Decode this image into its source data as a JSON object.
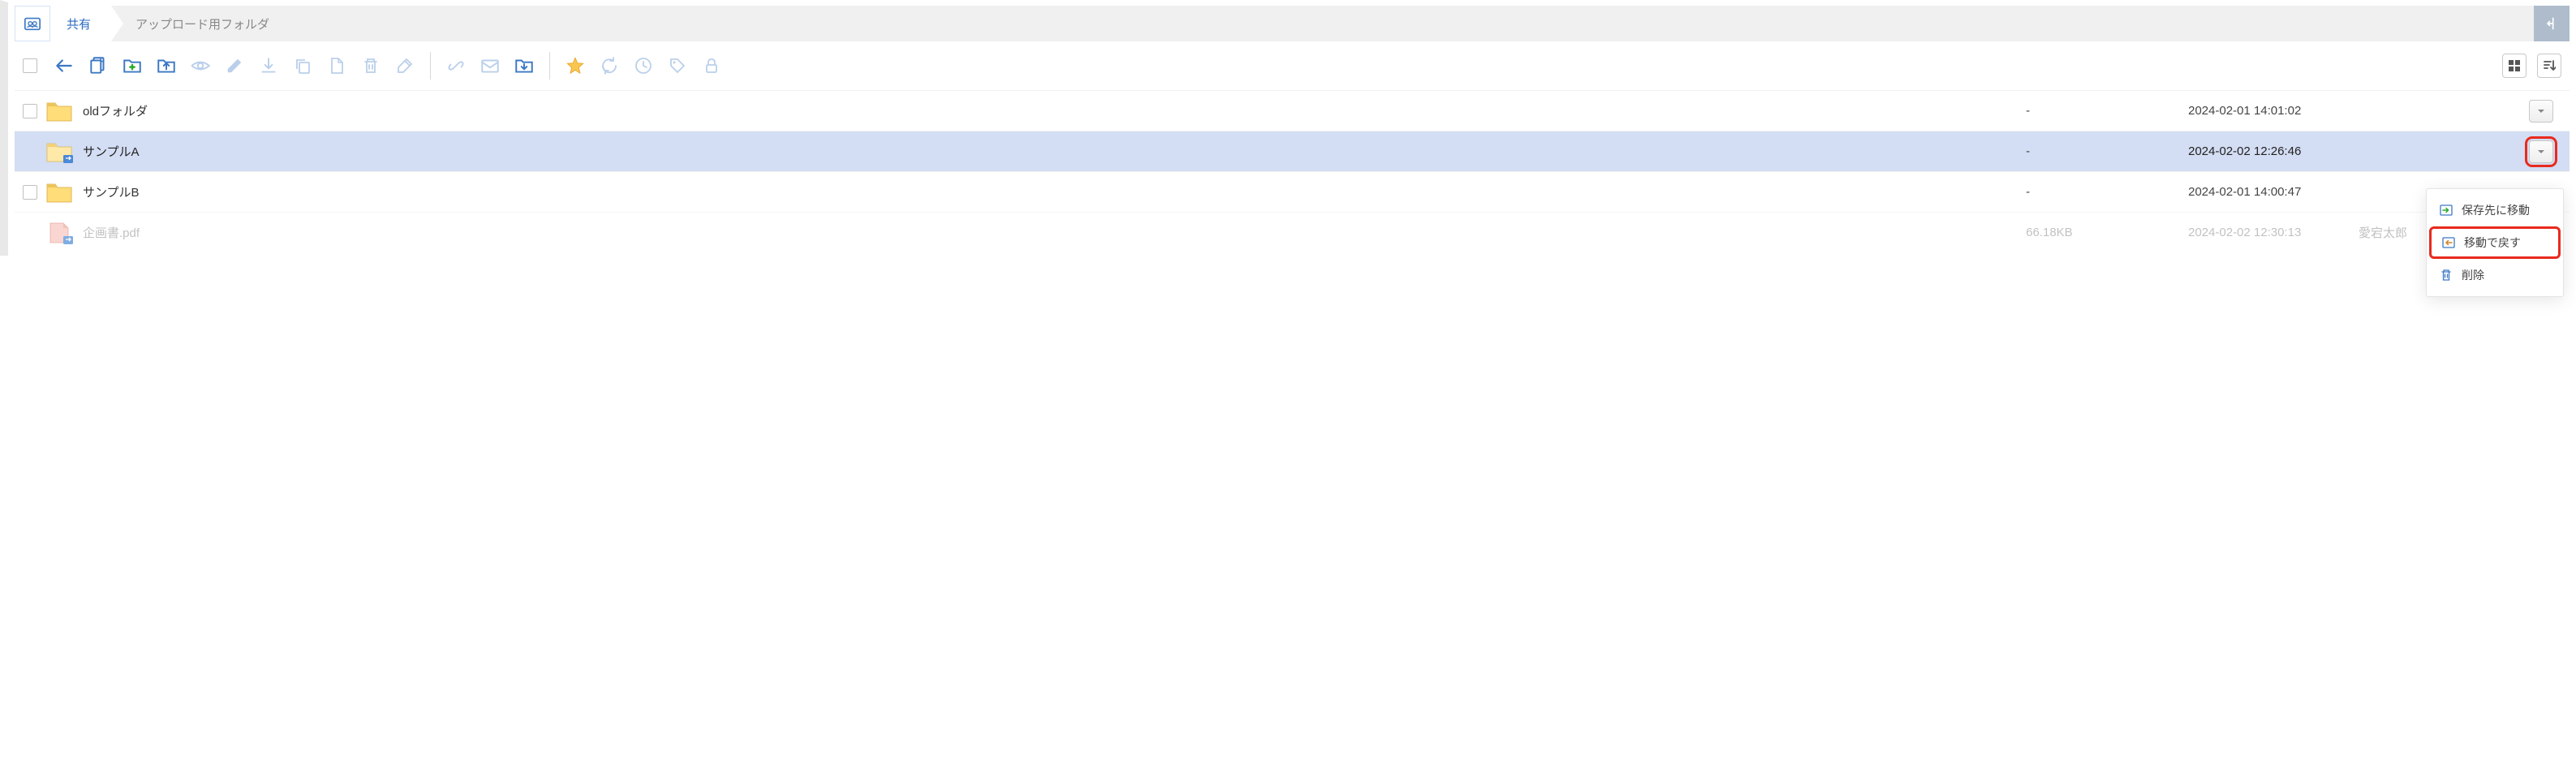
{
  "breadcrumb": {
    "root_label": "共有",
    "current_label": "アップロード用フォルダ"
  },
  "files": [
    {
      "name": "oldフォルダ",
      "size": "-",
      "date": "2024-02-01 14:01:02",
      "owner": "",
      "type": "folder",
      "selected": false,
      "has_checkbox": true,
      "has_dropdown": true
    },
    {
      "name": "サンプルA",
      "size": "-",
      "date": "2024-02-02 12:26:46",
      "owner": "",
      "type": "folder-shared",
      "selected": true,
      "has_checkbox": false,
      "has_dropdown": true,
      "dropdown_highlighted": true
    },
    {
      "name": "サンプルB",
      "size": "-",
      "date": "2024-02-01 14:00:47",
      "owner": "",
      "type": "folder",
      "selected": false,
      "has_checkbox": true,
      "has_dropdown": false
    },
    {
      "name": "企画書.pdf",
      "size": "66.18KB",
      "date": "2024-02-02 12:30:13",
      "owner": "愛宕太郎",
      "type": "pdf-shared",
      "selected": false,
      "sub": true,
      "has_checkbox": false,
      "has_dropdown": false
    }
  ],
  "context_menu": {
    "items": [
      {
        "label": "保存先に移動",
        "icon": "move-to"
      },
      {
        "label": "移動で戻す",
        "icon": "move-back",
        "highlighted": true
      },
      {
        "label": "削除",
        "icon": "delete"
      }
    ]
  }
}
